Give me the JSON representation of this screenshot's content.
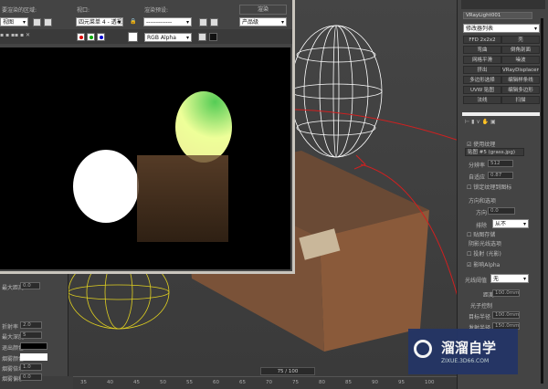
{
  "render_window": {
    "area_label": "要渲染的区域:",
    "area_value": "视图",
    "viewport_label": "视口:",
    "viewport_value": "四元菜单 4 - 透视",
    "preset_label": "渲染预设:",
    "preset_value": "-------------",
    "render_button": "渲染",
    "render_mode": "产品级",
    "channel": "RGB Alpha"
  },
  "command_panel": {
    "object_name": "VRayLight001",
    "modifier_list": "修改器列表",
    "modifiers": [
      "FFD 2x2x2",
      "壳",
      "弯曲",
      "倒角剖面",
      "网格平滑",
      "噪波",
      "挤出",
      "VRayDisplacementMod",
      "多边形选择",
      "编辑样条线",
      "UVW 贴图",
      "编辑多边形",
      "法线",
      "扫描"
    ],
    "use_texture": "使用纹理",
    "texture_map": "贴图 #5 (grass.jpg)",
    "resolution_label": "分辨率",
    "resolution": "512",
    "adaptive_label": "自适应",
    "adaptive": "0.87",
    "lock_texture": "锁定纹理到图标",
    "options_group": "方向和选项",
    "direction_label": "方向",
    "direction": "0.0",
    "exclude_label": "排除",
    "exclude_value": "从不",
    "store_map": "贴图存储",
    "shadow_group": "阴影光线选项",
    "shadow_check": "投射 (光影)",
    "affect_alpha": "影响Alpha",
    "threshold_label": "光线阈值",
    "threshold_value": "无",
    "distance_label": "距离",
    "distance": "100.0mm",
    "photon_group": "光子控制",
    "target_radius_label": "目标半径",
    "target_radius": "100.0mm",
    "emit_radius_label": "发射半径",
    "emit_radius": "150.0mm"
  },
  "left_panel": {
    "max_dist_label": "最大距离",
    "max_dist": "0.0",
    "ior_label": "折射率",
    "ior": "2.0",
    "max_depth_label": "最大深度",
    "max_depth": "5",
    "exit_color_label": "退出颜色",
    "fog_color_label": "烟雾颜色",
    "fog_mult_label": "烟雾倍增",
    "fog_mult": "1.0",
    "fog_bias_label": "烟雾偏移",
    "fog_bias": "0.0"
  },
  "timeline": {
    "frame": "75 / 100",
    "ticks": [
      "35",
      "40",
      "45",
      "50",
      "55",
      "60",
      "65",
      "70",
      "75",
      "80",
      "85",
      "90",
      "95",
      "100"
    ]
  },
  "watermark": {
    "title": "溜溜自学",
    "url": "ZIXUE.3D66.COM"
  },
  "colors": {
    "annotation": "#d02020",
    "wire_white": "#ffffff",
    "wire_yellow": "#e0d020",
    "watermark_bg": "#243566"
  }
}
